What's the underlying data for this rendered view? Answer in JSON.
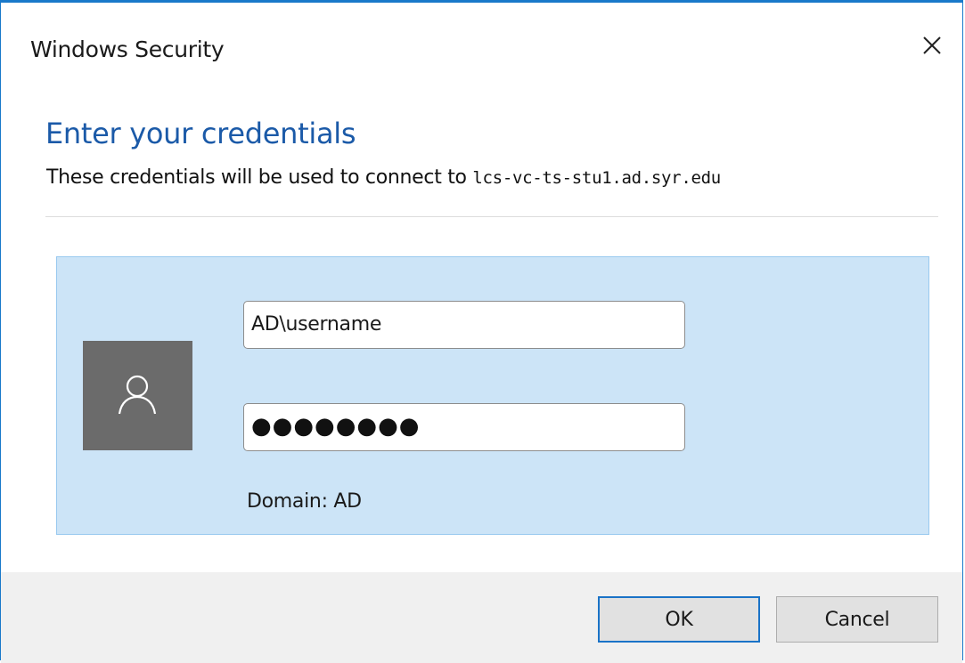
{
  "window": {
    "title": "Windows Security"
  },
  "dialog": {
    "heading": "Enter your credentials",
    "subtext_prefix": "These credentials will be used to connect to ",
    "host": "lcs-vc-ts-stu1.ad.syr.edu"
  },
  "credentials": {
    "username": "AD\\username",
    "password_mask": "●●●●●●●●",
    "domain": "Domain: AD"
  },
  "buttons": {
    "ok_label": "OK",
    "cancel_label": "Cancel"
  },
  "icons": {
    "close": "close-icon",
    "avatar": "user-icon"
  },
  "colors": {
    "accent": "#1b5aa8",
    "tile_bg": "#cce4f7",
    "avatar_bg": "#6b6b6b"
  }
}
